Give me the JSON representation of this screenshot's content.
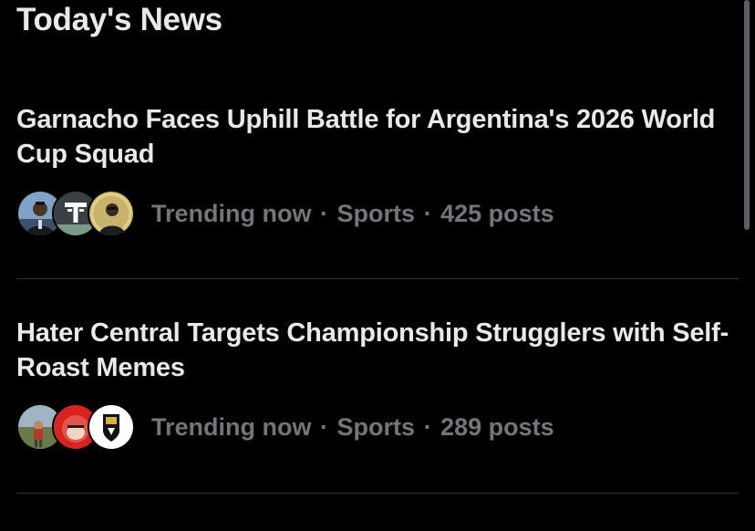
{
  "section": {
    "title": "Today's News"
  },
  "news": [
    {
      "headline": "Garnacho Faces Uphill Battle for Argentina's 2026 World Cup Squad",
      "status": "Trending now",
      "category": "Sports",
      "posts": "425 posts",
      "separator": "·"
    },
    {
      "headline": "Hater Central Targets Championship Strugglers with Self-Roast Memes",
      "status": "Trending now",
      "category": "Sports",
      "posts": "289 posts",
      "separator": "·"
    }
  ],
  "colors": {
    "background": "#000000",
    "primary_text": "#e7e9ea",
    "secondary_text": "#71767b",
    "divider": "#2f3336",
    "scrollbar": "#5b5e62"
  },
  "icons": {
    "news_1_avatars": [
      "player-photo-avatar",
      "t-logo-avatar",
      "coach-photo-avatar"
    ],
    "news_2_avatars": [
      "outdoor-photo-avatar",
      "red-face-avatar",
      "crest-avatar"
    ]
  }
}
